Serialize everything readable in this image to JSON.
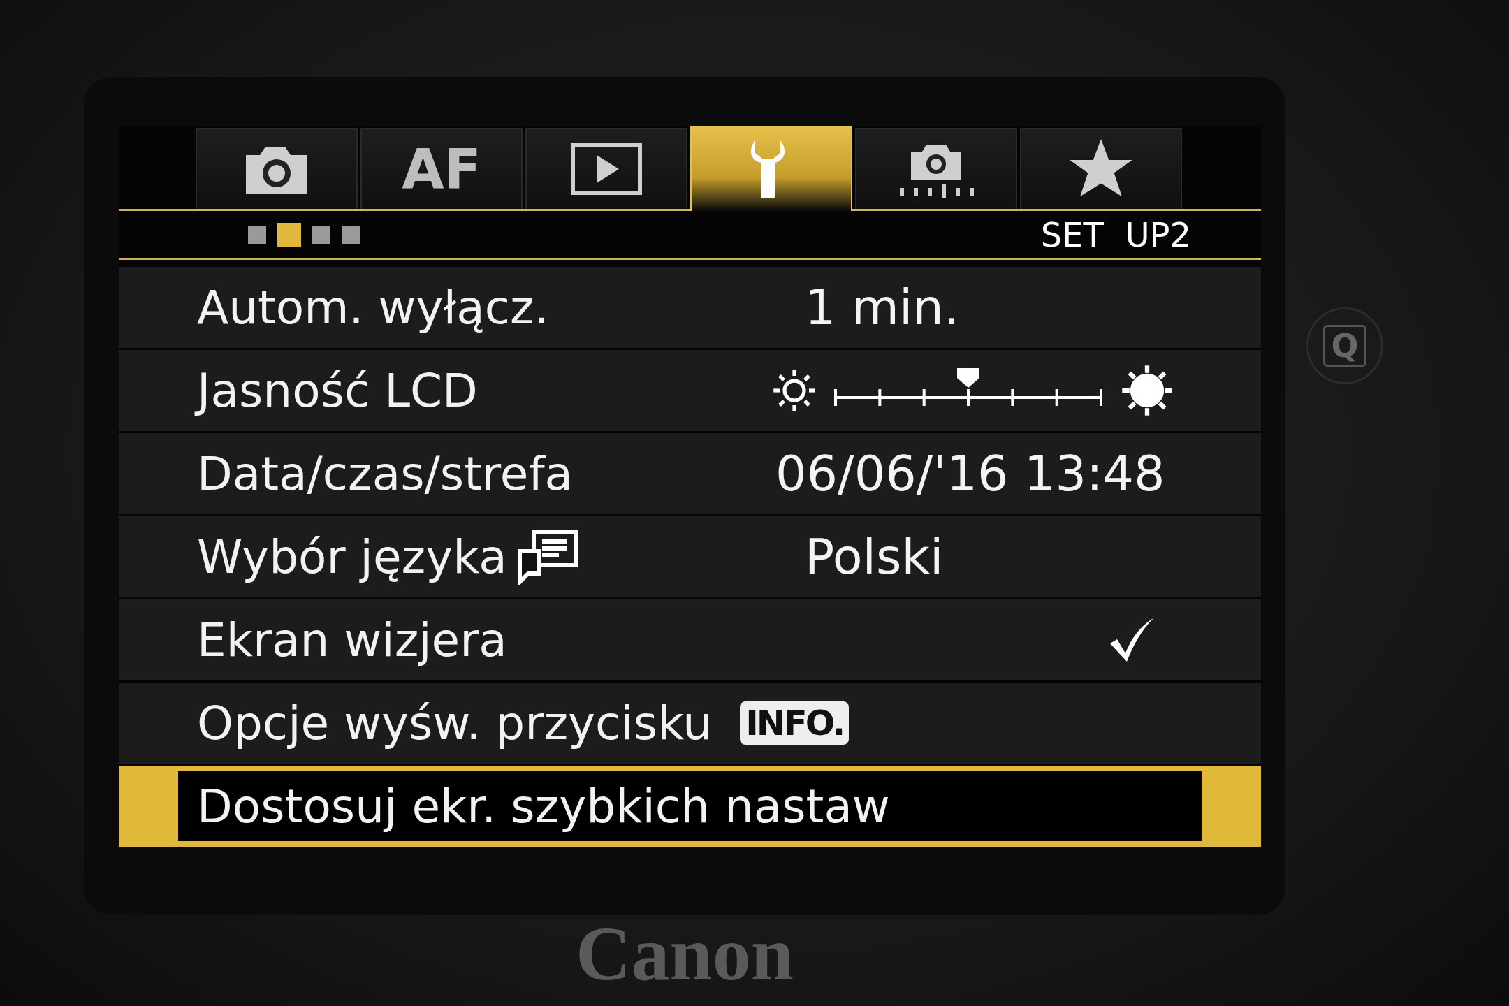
{
  "tabs": [
    {
      "kind": "camera",
      "selected": false
    },
    {
      "kind": "text",
      "label": "AF",
      "selected": false
    },
    {
      "kind": "play",
      "selected": false
    },
    {
      "kind": "wrench",
      "selected": true
    },
    {
      "kind": "camera-dots",
      "selected": false
    },
    {
      "kind": "star",
      "selected": false
    }
  ],
  "page_dots": [
    {
      "selected": false
    },
    {
      "selected": true
    },
    {
      "selected": false
    },
    {
      "selected": false
    }
  ],
  "menu_title": "SET  UP2",
  "rows": [
    {
      "kind": "value",
      "label": "Autom. wyłącz.",
      "value": "1 min.",
      "selected": false
    },
    {
      "kind": "slider",
      "label": "Jasność LCD",
      "level": 0.5,
      "selected": false
    },
    {
      "kind": "value",
      "label": "Data/czas/strefa",
      "value": "06/06/'16 13:48",
      "selected": false
    },
    {
      "kind": "language",
      "label": "Wybór języka",
      "value": "Polski",
      "selected": false
    },
    {
      "kind": "check",
      "label": "Ekran wizjera",
      "checked": true,
      "selected": false
    },
    {
      "kind": "badge",
      "label": "Opcje wyśw. przycisku",
      "badge": "INFO.",
      "selected": false
    },
    {
      "kind": "plain",
      "label": "Dostosuj ekr. szybkich nastaw",
      "selected": true
    }
  ],
  "side_button": "Q",
  "brand": "Canon"
}
